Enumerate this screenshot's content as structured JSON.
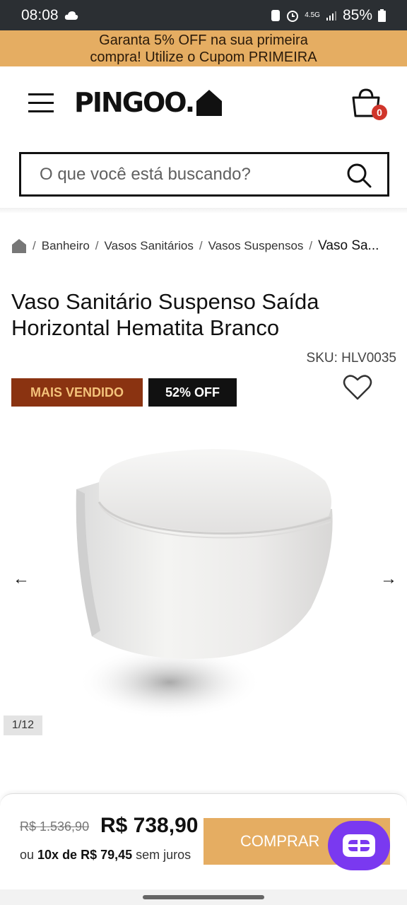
{
  "status_bar": {
    "time": "08:08",
    "battery": "85%",
    "network": "4.5G"
  },
  "promo": {
    "line1": "Garanta 5% OFF na sua primeira",
    "line2": "compra! Utilize o Cupom PRIMEIRA"
  },
  "header": {
    "logo": "PINGOO.",
    "cart_count": "0"
  },
  "search": {
    "placeholder": "O que você está buscando?"
  },
  "breadcrumb": {
    "items": [
      "Banheiro",
      "Vasos Sanitários",
      "Vasos Suspensos"
    ],
    "current": "Vaso Sa..."
  },
  "product": {
    "title": "Vaso Sanitário Suspenso Saída Horizontal Hematita Branco",
    "sku": "SKU: HLV0035",
    "badge_best": "MAIS VENDIDO",
    "badge_off": "52% OFF",
    "image_counter": "1/12"
  },
  "buy": {
    "old_price": "R$ 1.536,90",
    "new_price": "R$ 738,90",
    "installments_prefix": "ou ",
    "installments_bold": "10x de R$ 79,45",
    "installments_suffix": " sem juros",
    "button": "COMPRAR"
  },
  "colors": {
    "accent": "#e5ad62",
    "badge_best_bg": "#8a3311",
    "chat": "#7a39f0"
  }
}
